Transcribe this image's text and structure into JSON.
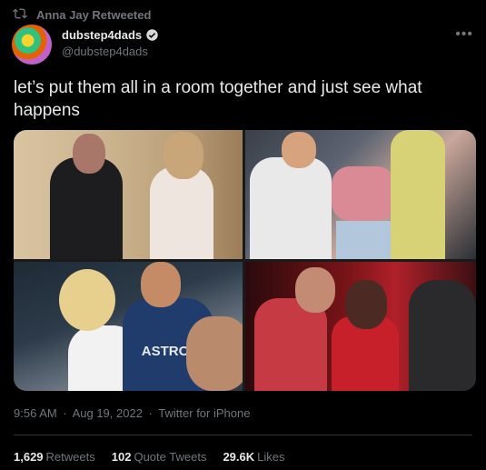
{
  "retweet": {
    "label": "Anna Jay Retweeted"
  },
  "author": {
    "display_name": "dubstep4dads",
    "handle": "@dubstep4dads"
  },
  "tweet": {
    "text": "let’s put them all in a room together and just see what happens",
    "time": "9:56 AM",
    "date": "Aug 19, 2022",
    "source": "Twitter for iPhone",
    "separator": "·"
  },
  "stats": {
    "retweets": {
      "count": "1,629",
      "label": "Retweets"
    },
    "quotes": {
      "count": "102",
      "label": "Quote Tweets"
    },
    "likes": {
      "count": "29.6K",
      "label": "Likes"
    }
  },
  "media": {
    "photo_4_sign": "ASTROS"
  },
  "colors": {
    "background": "#000000",
    "text": "#e7e9ea",
    "muted": "#71767b",
    "verified": "#d9d9d9"
  }
}
